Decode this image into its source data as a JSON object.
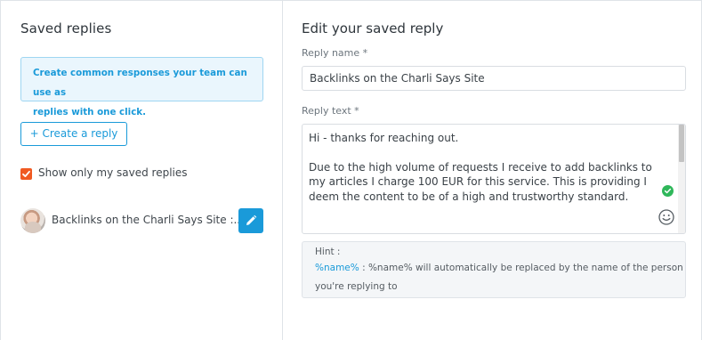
{
  "left": {
    "title": "Saved replies",
    "info": {
      "line1": "Create common responses your team can use as",
      "line2": "replies with one click."
    },
    "create_button": "+ Create a reply",
    "filter": {
      "label": "Show only my saved replies",
      "checked": true
    },
    "replies": [
      {
        "name": "Backlinks on the Charli Says Site :..."
      }
    ]
  },
  "right": {
    "title": "Edit your saved reply",
    "reply_name_label": "Reply name *",
    "reply_name_value": "Backlinks on the Charli Says Site",
    "reply_text_label": "Reply text *",
    "reply_text_value": "Hi - thanks for reaching out.\n\nDue to the high volume of requests I receive to add backlinks to my articles I charge 100 EUR for this service. This is providing I deem the content to be of a high and trustworthy standard.",
    "hint": {
      "title": "Hint :",
      "token": "%name%",
      "line1_rest": " : %name% will automatically be replaced by the name of the person",
      "line2": "you're replying to"
    }
  },
  "colors": {
    "accent": "#1a9ad9",
    "checkbox": "#f05a22",
    "success": "#2fb75a"
  }
}
